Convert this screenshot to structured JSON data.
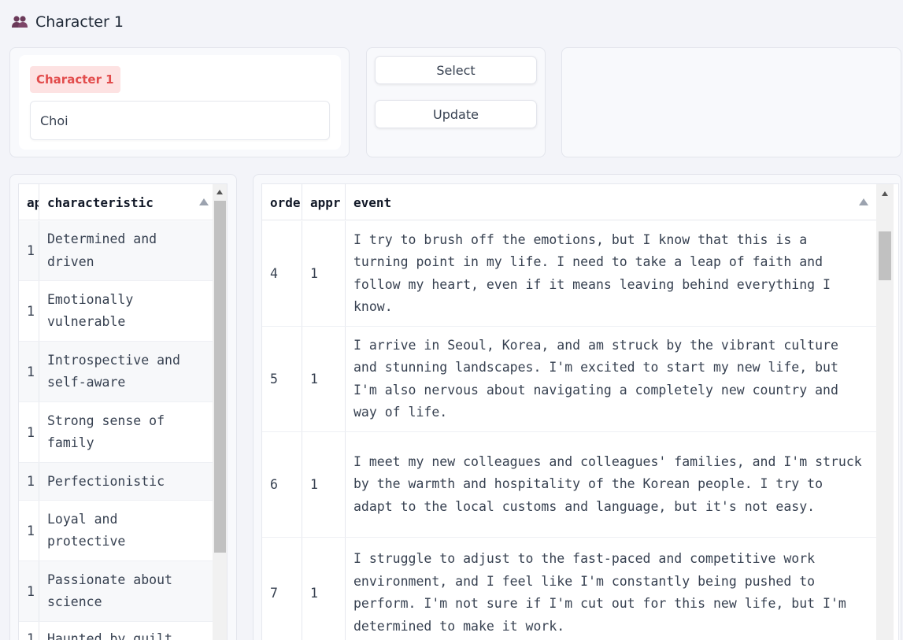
{
  "header": {
    "icon": "people-icon",
    "title": "Character 1"
  },
  "character": {
    "label": "Character 1",
    "name_value": "Choi"
  },
  "actions": {
    "select_label": "Select",
    "update_label": "Update"
  },
  "characteristics_table": {
    "columns": [
      "ap",
      "characteristic"
    ],
    "rows": [
      {
        "ap": "1",
        "characteristic": "Determined and driven"
      },
      {
        "ap": "1",
        "characteristic": "Emotionally vulnerable"
      },
      {
        "ap": "1",
        "characteristic": "Introspective and self-aware"
      },
      {
        "ap": "1",
        "characteristic": "Strong sense of family"
      },
      {
        "ap": "1",
        "characteristic": "Perfectionistic"
      },
      {
        "ap": "1",
        "characteristic": "Loyal and protective"
      },
      {
        "ap": "1",
        "characteristic": "Passionate about science"
      },
      {
        "ap": "1",
        "characteristic": "Haunted by guilt"
      }
    ]
  },
  "events_table": {
    "columns": [
      "orde",
      "appr",
      "event"
    ],
    "rows": [
      {
        "order": "4",
        "appr": "1",
        "event": "I try to brush off the emotions, but I know that this is a turning point in my life. I need to take a leap of faith and follow my heart, even if it means leaving behind everything I know."
      },
      {
        "order": "5",
        "appr": "1",
        "event": "I arrive in Seoul, Korea, and am struck by the vibrant culture and stunning landscapes. I'm excited to start my new life, but I'm also nervous about navigating a completely new country and way of life."
      },
      {
        "order": "6",
        "appr": "1",
        "event": "I meet my new colleagues and colleagues' families, and I'm struck by the warmth and hospitality of the Korean people. I try to adapt to the local customs and language, but it's not easy."
      },
      {
        "order": "7",
        "appr": "1",
        "event": "I struggle to adjust to the fast-paced and competitive work environment, and I feel like I'm constantly being pushed to perform. I'm not sure if I'm cut out for this new life, but I'm determined to make it work."
      }
    ]
  }
}
